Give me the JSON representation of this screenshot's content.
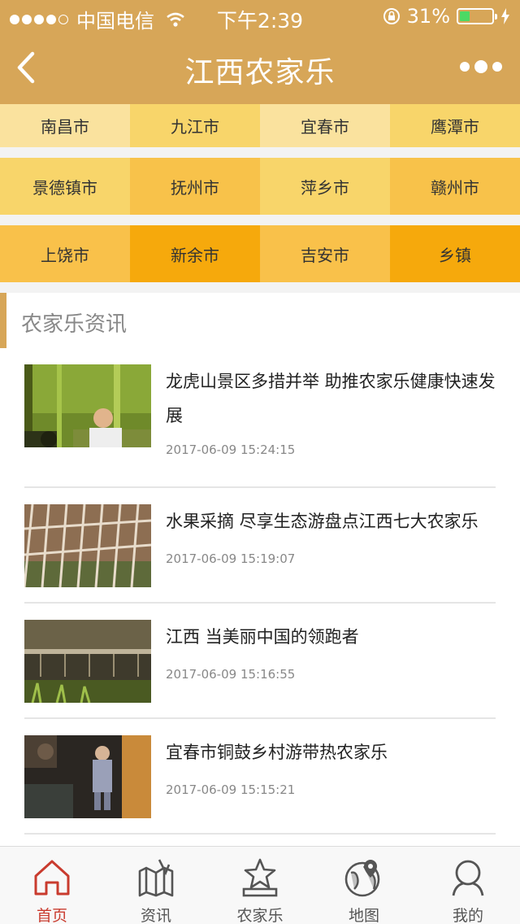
{
  "status_bar": {
    "carrier": "中国电信",
    "time": "下午2:39",
    "battery": "31%",
    "battery_level": 0.31
  },
  "nav": {
    "title": "江西农家乐"
  },
  "cities": [
    [
      {
        "name": "南昌市",
        "color": "#fae29e"
      },
      {
        "name": "九江市",
        "color": "#f8d56a"
      },
      {
        "name": "宜春市",
        "color": "#fae29e"
      },
      {
        "name": "鹰潭市",
        "color": "#f8d56a"
      }
    ],
    [
      {
        "name": "景德镇市",
        "color": "#f8d56a"
      },
      {
        "name": "抚州市",
        "color": "#f8c24a"
      },
      {
        "name": "萍乡市",
        "color": "#f8d56a"
      },
      {
        "name": "赣州市",
        "color": "#f8c24a"
      }
    ],
    [
      {
        "name": "上饶市",
        "color": "#f9c14a"
      },
      {
        "name": "新余市",
        "color": "#f6a90c"
      },
      {
        "name": "吉安市",
        "color": "#f9c14a"
      },
      {
        "name": "乡镇",
        "color": "#f6a90c"
      }
    ]
  ],
  "news": {
    "heading": "农家乐资讯",
    "items": [
      {
        "title": "龙虎山景区多措并举 助推农家乐健康快速发展",
        "time": "2017-06-09 15:24:15"
      },
      {
        "title": "水果采摘 尽享生态游盘点江西七大农家乐",
        "time": "2017-06-09 15:19:07"
      },
      {
        "title": "江西 当美丽中国的领跑者",
        "time": "2017-06-09 15:16:55"
      },
      {
        "title": "宜春市铜鼓乡村游带热农家乐",
        "time": "2017-06-09 15:15:21"
      }
    ]
  },
  "tabs": [
    {
      "label": "首页",
      "icon": "home-icon",
      "active": true
    },
    {
      "label": "资讯",
      "icon": "news-icon",
      "active": false
    },
    {
      "label": "农家乐",
      "icon": "star-icon",
      "active": false
    },
    {
      "label": "地图",
      "icon": "globe-pin-icon",
      "active": false
    },
    {
      "label": "我的",
      "icon": "user-icon",
      "active": false
    }
  ],
  "colors": {
    "brand": "#d7a658",
    "active_tab": "#c93b2e"
  }
}
